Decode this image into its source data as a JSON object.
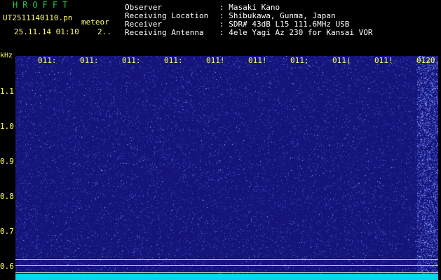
{
  "header": {
    "logo": "HROFFT",
    "file_name": "UT2511140110.pn",
    "kind": "meteor",
    "timestamp": "25.11.14 01:10",
    "count": "2..",
    "observer_label": "Observer",
    "observer_value": ": Masaki Kano",
    "location_label": "Receiving Location",
    "location_value": ": Shibukawa, Gunma, Japan",
    "receiver_label": "Receiver",
    "receiver_value": ": SDR# 43dB L15 111.6MHz USB",
    "antenna_label": "Receiving Antenna",
    "antenna_value": ": 4ele Yagi Az 230 for Kansai VOR"
  },
  "spectrogram": {
    "y_unit": "kHz",
    "x_ticks": [
      "011:",
      "011:",
      "011:",
      "011:",
      "011!",
      "011!",
      "011;",
      "011(",
      "011!",
      "0120"
    ],
    "y_ticks": [
      "1.1",
      "1.0",
      "0.9",
      "0.8",
      "0.7",
      "0.6"
    ],
    "colors": {
      "background": "#14147a",
      "noise": "#4a5cd8",
      "bright": "#9ab0ff",
      "band": "#00d8e8",
      "ticks": "#ffff66"
    }
  }
}
